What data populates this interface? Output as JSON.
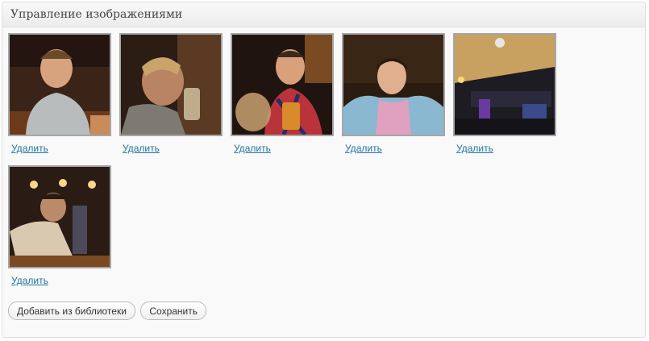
{
  "panel": {
    "title": "Управление изображениями"
  },
  "images": [
    {
      "delete_label": "Удалить",
      "icon": "photo-thumbnail"
    },
    {
      "delete_label": "Удалить",
      "icon": "photo-thumbnail"
    },
    {
      "delete_label": "Удалить",
      "icon": "photo-thumbnail"
    },
    {
      "delete_label": "Удалить",
      "icon": "photo-thumbnail"
    },
    {
      "delete_label": "Удалить",
      "icon": "photo-thumbnail"
    },
    {
      "delete_label": "Удалить",
      "icon": "photo-thumbnail"
    }
  ],
  "actions": {
    "add_from_library_label": "Добавить из библиотеки",
    "save_label": "Сохранить"
  },
  "colors": {
    "link": "#21759b",
    "thumb_border": "#a6a6a6",
    "panel_bg": "#f9f9f9"
  }
}
